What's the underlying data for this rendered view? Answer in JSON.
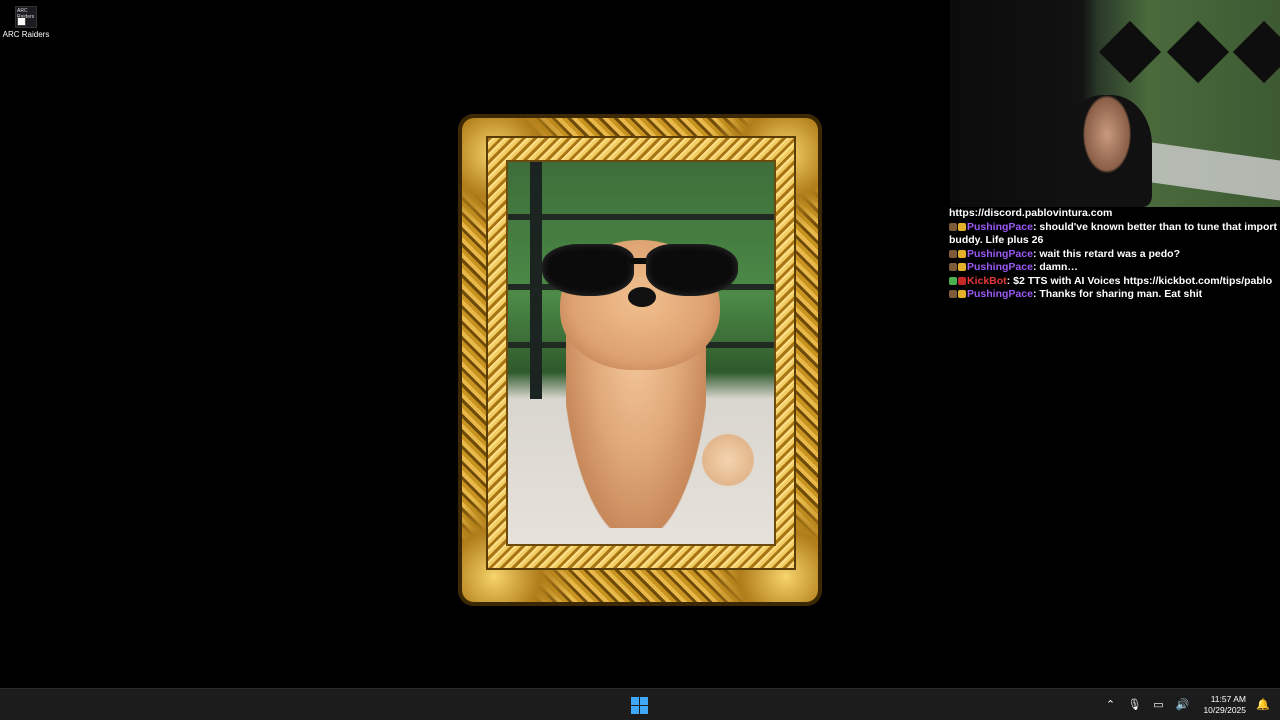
{
  "desktop": {
    "icon_label": "ARC Raiders",
    "icon_art_text": "ARC Raiders"
  },
  "chat": {
    "link": "https://discord.pablovintura.com",
    "messages": [
      {
        "user": "PushingPace",
        "text": ": should've known better than to tune that import buddy. Life plus 26",
        "bot": false
      },
      {
        "user": "PushingPace",
        "text": ": wait this retard was a pedo?",
        "bot": false
      },
      {
        "user": "PushingPace",
        "text": ": damn…",
        "bot": false
      },
      {
        "user": "KickBot",
        "text": ": $2 TTS with AI Voices https://kickbot.com/tips/pablo",
        "bot": true
      },
      {
        "user": "PushingPace",
        "text": ": Thanks for sharing man. Eat shit",
        "bot": false
      }
    ]
  },
  "taskbar": {
    "time": "11:57 AM",
    "date": "10/29/2025",
    "icons": [
      "chevron-up-icon",
      "microphone-icon",
      "network-icon",
      "volume-icon",
      "notification-icon"
    ]
  },
  "colors": {
    "username": "#9b59f5",
    "bot_username": "#e53935",
    "taskbar_bg": "#1c1c1c",
    "start_blue": "#3fa7f5"
  }
}
